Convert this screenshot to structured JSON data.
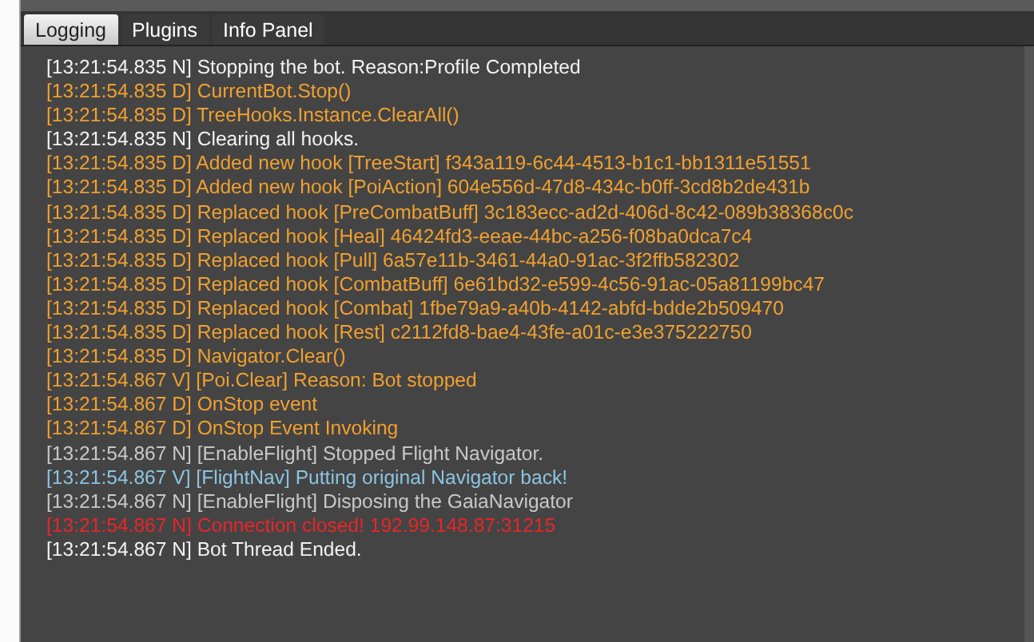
{
  "tabs": [
    {
      "label": "Logging",
      "selected": true
    },
    {
      "label": "Plugins",
      "selected": false
    },
    {
      "label": "Info Panel",
      "selected": false
    }
  ],
  "log": [
    {
      "text": "[13:21:54.835 N] Stopping the bot. Reason:Profile Completed",
      "color": "#f2f2f2"
    },
    {
      "text": "[13:21:54.835 D] CurrentBot.Stop()",
      "color": "#f0a030"
    },
    {
      "text": "[13:21:54.835 D] TreeHooks.Instance.ClearAll()",
      "color": "#f0a030"
    },
    {
      "text": "[13:21:54.835 N] Clearing all hooks.",
      "color": "#f2f2f2"
    },
    {
      "text": "[13:21:54.835 D] Added new hook [TreeStart] f343a119-6c44-4513-b1c1-bb1311e51551",
      "color": "#f0a030"
    },
    {
      "text": "[13:21:54.835 D] Added new hook [PoiAction] 604e556d-47d8-434c-b0ff-3cd8b2de431b",
      "color": "#f0a030"
    },
    {
      "text": "[13:21:54.835 D] Replaced hook [PreCombatBuff] 3c183ecc-ad2d-406d-8c42-089b38368c0c",
      "color": "#f0a030"
    },
    {
      "text": "[13:21:54.835 D] Replaced hook [Heal] 46424fd3-eeae-44bc-a256-f08ba0dca7c4",
      "color": "#f0a030"
    },
    {
      "text": "[13:21:54.835 D] Replaced hook [Pull] 6a57e11b-3461-44a0-91ac-3f2ffb582302",
      "color": "#f0a030"
    },
    {
      "text": "[13:21:54.835 D] Replaced hook [CombatBuff] 6e61bd32-e599-4c56-91ac-05a81199bc47",
      "color": "#f0a030"
    },
    {
      "text": "[13:21:54.835 D] Replaced hook [Combat] 1fbe79a9-a40b-4142-abfd-bdde2b509470",
      "color": "#f0a030"
    },
    {
      "text": "[13:21:54.835 D] Replaced hook [Rest] c2112fd8-bae4-43fe-a01c-e3e375222750",
      "color": "#f0a030"
    },
    {
      "text": "[13:21:54.835 D] Navigator.Clear()",
      "color": "#f0a030"
    },
    {
      "text": "[13:21:54.867 V] [Poi.Clear] Reason: Bot stopped",
      "color": "#f0a030"
    },
    {
      "text": "[13:21:54.867 D] OnStop event",
      "color": "#f0a030"
    },
    {
      "text": "[13:21:54.867 D] OnStop Event Invoking",
      "color": "#f0a030"
    },
    {
      "text": "[13:21:54.867 N] [EnableFlight] Stopped Flight Navigator.",
      "color": "#c8c8c8"
    },
    {
      "text": "[13:21:54.867 V] [FlightNav] Putting original Navigator back!",
      "color": "#8cc4e0"
    },
    {
      "text": "[13:21:54.867 N] [EnableFlight] Disposing the GaiaNavigator",
      "color": "#c8c8c8"
    },
    {
      "text": "[13:21:54.867 N] Connection closed! 192.99.148.87:31215",
      "color": "#e8262a"
    },
    {
      "text": "[13:21:54.867 N] Bot Thread Ended.",
      "color": "#f2f2f2"
    }
  ]
}
